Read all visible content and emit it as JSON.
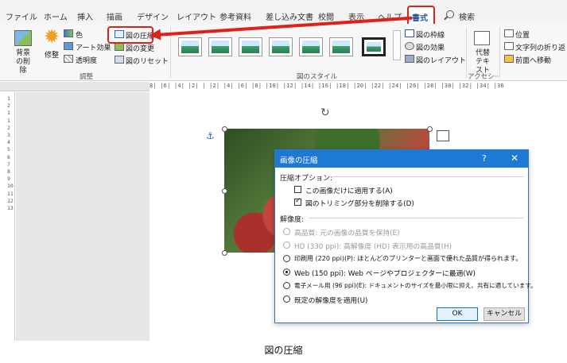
{
  "tabs": [
    {
      "label": "ファイル"
    },
    {
      "label": "ホーム"
    },
    {
      "label": "挿入"
    },
    {
      "label": "描画"
    },
    {
      "label": "デザイン"
    },
    {
      "label": "レイアウト"
    },
    {
      "label": "参考資料"
    },
    {
      "label": "差し込み文書"
    },
    {
      "label": "校閲"
    },
    {
      "label": "表示"
    },
    {
      "label": "ヘルプ"
    },
    {
      "label": "書式"
    }
  ],
  "search_label": "検索",
  "ribbon": {
    "remove_bg": "背景の削除",
    "corrections": "修整",
    "color": "色",
    "artistic": "アート効果",
    "transparency": "透明度",
    "compress": "図の圧縮",
    "change": "図の変更",
    "reset": "図のリセット",
    "adjust_group": "調整",
    "styles_group": "図のスタイル",
    "border": "図の枠線",
    "effects": "図の効果",
    "layout": "図のレイアウト",
    "alt_text": "代替テキスト",
    "accessibility_group": "アクセシ···",
    "position": "位置",
    "wrap_text": "文字列の折り返し",
    "bring_forward": "前面へ移動"
  },
  "ruler": {
    "horizontal": "8| |6| |4| |2| | |2| |4| |6| |8| |10| |12| |14| |16| |18| |20| |22| |24| |26| |28| |30| |32| |34| |36",
    "vertical": "1 2 1 1 2 3 4 5 6 7 8 9 10 11 12 13"
  },
  "dialog": {
    "title": "画像の圧縮",
    "help": "?",
    "close": "✕",
    "compress_options_title": "圧縮オプション:",
    "opt_apply_only": "この画像だけに適用する(A)",
    "opt_delete_crop": "図のトリミング部分を削除する(D)",
    "resolution_title": "解像度:",
    "res_high": "高品質: 元の画像の品質を保持(E)",
    "res_hd": "HD (330 ppi): 高解像度 (HD) 表示用の高品質(H)",
    "res_print": "印刷用 (220 ppi)(P): ほとんどのプリンターと画面で優れた品質が得られます。",
    "res_web": "Web (150 ppi): Web ページやプロジェクターに最適(W)",
    "res_email": "電子メール用 (96 ppi)(E): ドキュメントのサイズを最小限に抑え、共有に適しています。",
    "res_default": "既定の解像度を適用(U)",
    "ok": "OK",
    "cancel": "キャンセル"
  },
  "caption": "図の圧縮"
}
